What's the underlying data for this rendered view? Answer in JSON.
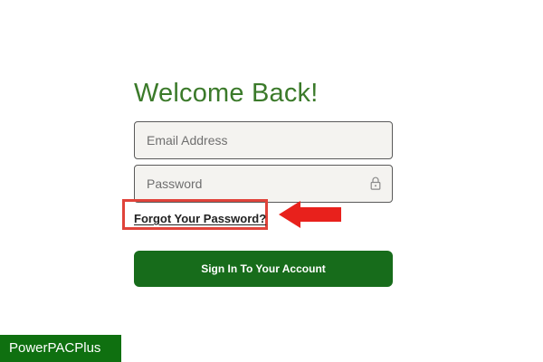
{
  "login": {
    "title": "Welcome Back!",
    "email_placeholder": "Email Address",
    "password_placeholder": "Password",
    "forgot_password_label": "Forgot Your Password?",
    "sign_in_label": "Sign In To Your Account"
  },
  "icons": {
    "password_field": "lock-icon",
    "annotation": "arrow-left-icon"
  },
  "watermark": {
    "text": "PowerPACPlus"
  },
  "colors": {
    "title": "#3b7a2a",
    "primary_button": "#176c1b",
    "highlight": "#e0433a",
    "watermark_bg": "#0f7010"
  }
}
